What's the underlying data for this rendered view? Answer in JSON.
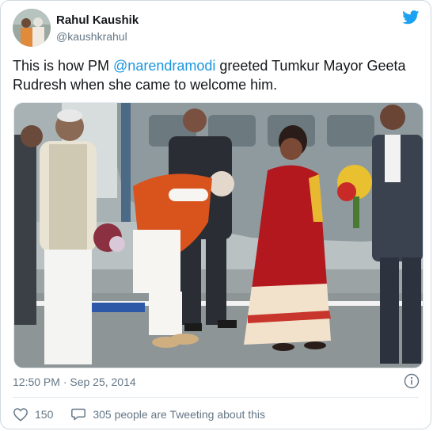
{
  "tweet": {
    "author_name": "Rahul Kaushik",
    "author_handle": "@kaushkrahul",
    "text_before": "This is how PM ",
    "mention": "@narendramodi",
    "text_after": " greeted Tumkur Mayor Geeta Rudresh when she came to welcome him.",
    "timestamp": "12:50 PM · Sep 25, 2014",
    "likes": "150",
    "reply_text": "305 people are Tweeting about this"
  },
  "icons": {
    "logo": "twitter-bird-icon",
    "info": "info-icon",
    "like": "heart-icon",
    "reply": "speech-bubble-icon"
  },
  "colors": {
    "accent": "#1da1f2",
    "mention": "#1b95e0",
    "muted": "#657786",
    "text": "#14171a"
  }
}
